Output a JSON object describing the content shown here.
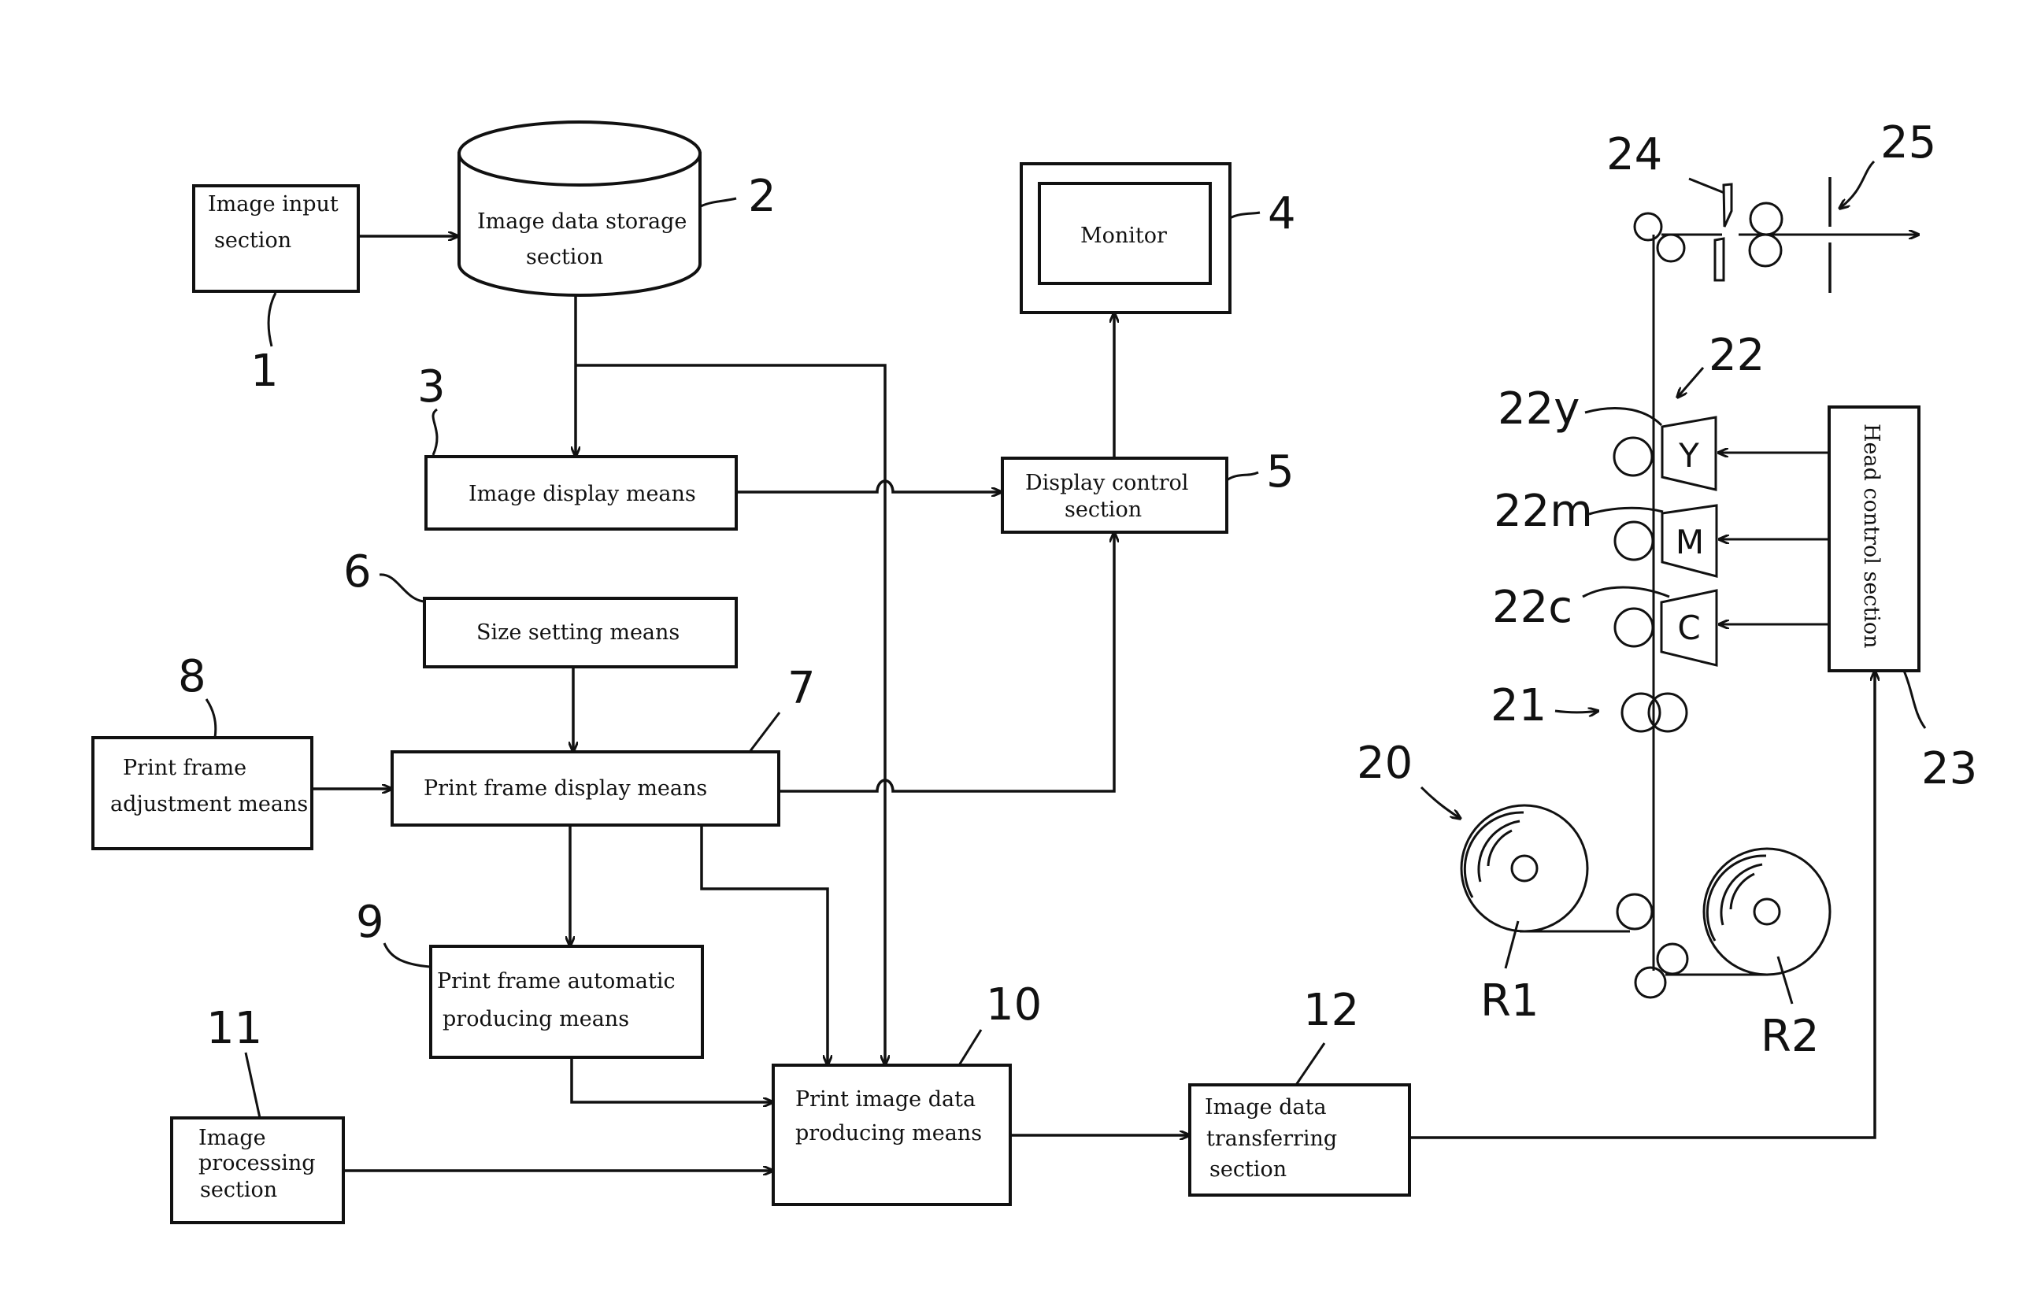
{
  "figure": {
    "type": "block diagram with printer mechanism",
    "blocks": {
      "image_input": {
        "ref": "1",
        "lines": [
          "Image input",
          "section"
        ]
      },
      "image_data_storage": {
        "ref": "2",
        "lines": [
          "Image data storage",
          "section"
        ]
      },
      "image_display": {
        "ref": "3",
        "lines": [
          "Image display means"
        ]
      },
      "monitor": {
        "ref": "4",
        "lines": [
          "Monitor"
        ]
      },
      "display_control": {
        "ref": "5",
        "lines": [
          "Display control",
          "section"
        ]
      },
      "size_setting": {
        "ref": "6",
        "lines": [
          "Size setting means"
        ]
      },
      "print_frame_display": {
        "ref": "7",
        "lines": [
          "Print frame display means"
        ]
      },
      "print_frame_adjustment": {
        "ref": "8",
        "lines": [
          "Print frame",
          "adjustment means"
        ]
      },
      "print_frame_automatic": {
        "ref": "9",
        "lines": [
          "Print frame automatic",
          "producing means"
        ]
      },
      "print_image_data": {
        "ref": "10",
        "lines": [
          "Print image data",
          "producing means"
        ]
      },
      "image_processing": {
        "ref": "11",
        "lines": [
          "Image",
          "processing",
          "section"
        ]
      },
      "image_data_transferring": {
        "ref": "12",
        "lines": [
          "Image data",
          "transferring",
          "section"
        ]
      },
      "head_control": {
        "ref": "23",
        "lines": [
          "Head control section"
        ]
      }
    },
    "mechanism": {
      "roll_unit": "20",
      "feed_rollers": "21",
      "print_heads_group": "22",
      "head_yellow": {
        "ref": "22y",
        "letter": "Y"
      },
      "head_magenta": {
        "ref": "22m",
        "letter": "M"
      },
      "head_cyan": {
        "ref": "22c",
        "letter": "C"
      },
      "cutter": "24",
      "exit": "25",
      "roll_1": "R1",
      "roll_2": "R2"
    },
    "connections": [
      {
        "from": "image_input",
        "to": "image_data_storage"
      },
      {
        "from": "image_data_storage",
        "to": "image_display"
      },
      {
        "from": "image_data_storage",
        "to": "print_image_data"
      },
      {
        "from": "image_display",
        "to": "display_control"
      },
      {
        "from": "display_control",
        "to": "monitor"
      },
      {
        "from": "size_setting",
        "to": "print_frame_display"
      },
      {
        "from": "print_frame_adjustment",
        "to": "print_frame_display"
      },
      {
        "from": "print_frame_display",
        "to": "display_control"
      },
      {
        "from": "print_frame_display",
        "to": "print_frame_automatic"
      },
      {
        "from": "print_frame_display",
        "to": "print_image_data"
      },
      {
        "from": "print_frame_automatic",
        "to": "print_image_data"
      },
      {
        "from": "image_processing",
        "to": "print_image_data"
      },
      {
        "from": "print_image_data",
        "to": "image_data_transferring"
      },
      {
        "from": "image_data_transferring",
        "to": "head_control"
      },
      {
        "from": "head_control",
        "to": "head_yellow"
      },
      {
        "from": "head_control",
        "to": "head_magenta"
      },
      {
        "from": "head_control",
        "to": "head_cyan"
      }
    ]
  }
}
